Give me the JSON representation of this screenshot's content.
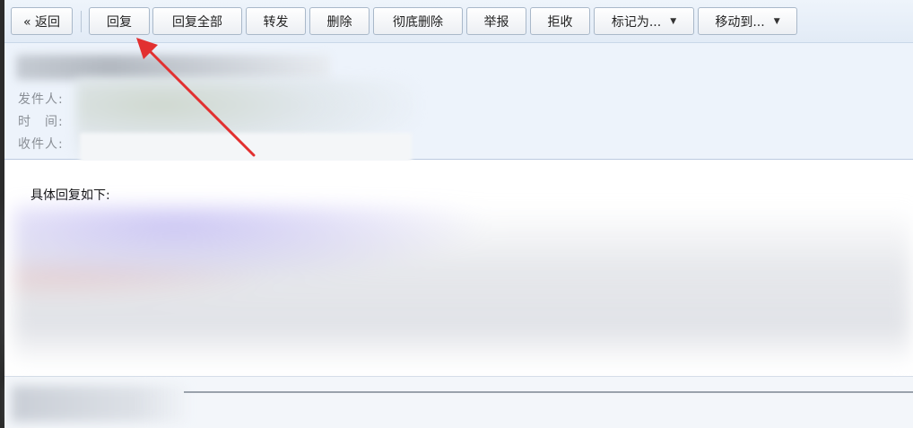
{
  "toolbar": {
    "back": "« 返回",
    "reply": "回复",
    "reply_all": "回复全部",
    "forward": "转发",
    "delete": "删除",
    "delete_permanently": "彻底删除",
    "report": "举报",
    "reject": "拒收",
    "mark_as": "标记为...",
    "move_to": "移动到..."
  },
  "header": {
    "from_label": "发件人:",
    "time_label": "时　间:",
    "to_label": "收件人:"
  },
  "body": {
    "intro": "具体回复如下:"
  },
  "colors": {
    "arrow": "#e23030",
    "toolbar_bg": "#e6eef8",
    "header_bg": "#edf3fb"
  },
  "icons": {
    "dropdown": "chevron-down-icon",
    "annotation": "arrow-annotation"
  }
}
